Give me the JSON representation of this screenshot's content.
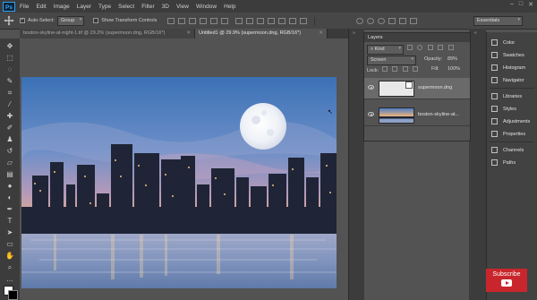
{
  "app": {
    "logo": "Ps"
  },
  "menu": [
    "File",
    "Edit",
    "Image",
    "Layer",
    "Type",
    "Select",
    "Filter",
    "3D",
    "View",
    "Window",
    "Help"
  ],
  "options": {
    "auto_select_label": "Auto-Select:",
    "auto_select_value": "Group",
    "show_transform_label": "Show Transform Controls",
    "workspace": "Essentials"
  },
  "tabs": [
    {
      "label": "boston-skyline-at-night-1.tif @ 29.2% (supermoon.dng, RGB/16*)",
      "active": false
    },
    {
      "label": "Untitled1 @ 29.9% (supermoon.dng, RGB/16*)",
      "active": true
    }
  ],
  "layers": {
    "title": "Layers",
    "filter": "Kind",
    "blend_mode": "Screen",
    "opacity_label": "Opacity:",
    "opacity_value": "89%",
    "lock_label": "Lock:",
    "fill_label": "Fill:",
    "fill_value": "100%",
    "items": [
      {
        "name": "supermoon.dng",
        "selected": true
      },
      {
        "name": "boston-skyline-at...",
        "selected": false
      }
    ]
  },
  "right_panel": {
    "group1": [
      "Color",
      "Swatches",
      "Histogram",
      "Navigator"
    ],
    "group2": [
      "Libraries",
      "Styles",
      "Adjustments",
      "Properties"
    ],
    "group3": [
      "Channels",
      "Paths"
    ]
  },
  "subscribe": "Subscribe",
  "colors": {
    "accent": "#31a8ff",
    "subscribe": "#c8262c",
    "sky_top": "#3e74b8",
    "sky_horizon": "#f2b37a"
  }
}
